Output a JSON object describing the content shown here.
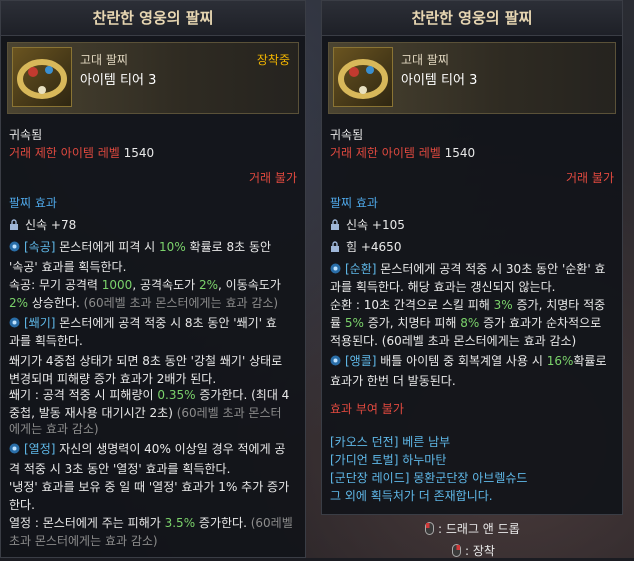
{
  "left": {
    "title": "찬란한 영웅의 팔찌",
    "grade": "고대 팔찌",
    "tier": "아이템 티어 3",
    "equipped": "장착중",
    "bound": "귀속됨",
    "level_label": "거래 제한 아이템 레벨",
    "level_value": "1540",
    "trade": "거래 불가",
    "effect_header": "팔찌 효과",
    "stat1": "신속 +78",
    "effects": {
      "l1a": "[속공]",
      "l1b": " 몬스터에게 피격 시 ",
      "l1c": "10%",
      "l1d": " 확률로 8초 동안",
      "l2": "'속공' 효과를 획득한다.",
      "l3a": "속공: 무기 공격력 ",
      "l3b": "1000",
      "l3c": ", 공격속도가 ",
      "l3d": "2%",
      "l3e": ", 이동속도가",
      "l4a": "2%",
      "l4b": " 상승한다. ",
      "l4c": "(60레벨 초과 몬스터에게는 효과 감소)",
      "l5a": "[쐐기]",
      "l5b": " 몬스터에게 공격 적중 시 8초 동안 '쐐기' 효",
      "l6": "과를 획득한다.",
      "l7": "쐐기가 4중첩 상태가 되면 8초 동안 '강철 쐐기' 상태로",
      "l8": "변경되며 피해량 증가 효과가 2배가 된다.",
      "l9a": "쐐기 : 공격 적중 시 피해량이 ",
      "l9b": "0.35%",
      "l9c": " 증가한다. (최대 4",
      "l10a": "중첩, 발동 재사용 대기시간 2초) ",
      "l10b": "(60레벨 초과 몬스터",
      "l11": "에게는 효과 감소)",
      "l12a": "[열정]",
      "l12b": " 자신의 생명력이 40% 이상일 경우 적에게 공",
      "l13": "격 적중 시 3초 동안 '열정' 효과를 획득한다.",
      "l14": "'냉정' 효과를 보유 중 일 때 '열정' 효과가 1% 추가 증가",
      "l15": "한다.",
      "l16a": "열정 : 몬스터에게 주는 피해가 ",
      "l16b": "3.5%",
      "l16c": " 증가한다. ",
      "l16d": "(60레벨",
      "l17": "초과 몬스터에게는 효과 감소)"
    }
  },
  "right": {
    "title": "찬란한 영웅의 팔찌",
    "grade": "고대 팔찌",
    "tier": "아이템 티어 3",
    "bound": "귀속됨",
    "level_label": "거래 제한 아이템 레벨",
    "level_value": "1540",
    "trade": "거래 불가",
    "effect_header": "팔찌 효과",
    "stat1": "신속 +105",
    "stat2": "힘 +4650",
    "effects": {
      "r1a": "[순환]",
      "r1b": " 몬스터에게 공격 적중 시 30초 동안 '순환' 효",
      "r2": "과를 획득한다. 해당 효과는 갱신되지 않는다.",
      "r3a": "순환 : 10초 간격으로 스킬 피해 ",
      "r3b": "3%",
      "r3c": " 증가, 치명타 적중",
      "r4a": "률 ",
      "r4b": "5%",
      "r4c": " 증가, 치명타 피해 ",
      "r4d": "8%",
      "r4e": " 증가 효과가 순차적으로",
      "r5": "적용된다. (60레벨 초과 몬스터에게는 효과 감소)",
      "r6a": "[앵콜]",
      "r6b": " 배틀 아이템 중 회복계열 사용 시 ",
      "r6c": "16%",
      "r6d": "확률로",
      "r7": "효과가 한번 더 발동된다."
    },
    "grant_header": "효과 부여 불가",
    "sources": [
      "[카오스 던전] 베른 남부",
      "[가디언 토벌] 하누마탄",
      "[군단장 레이드] 몽환군단장 아브렐슈드",
      "그 외에 획득처가 더 존재합니다."
    ],
    "hint_drag": "드래그 앤 드롭",
    "hint_equip": "장착"
  },
  "colors": {
    "red": "#e0493f",
    "blue": "#4ea6e6",
    "green": "#7bd26b",
    "gold": "#f0b400"
  }
}
